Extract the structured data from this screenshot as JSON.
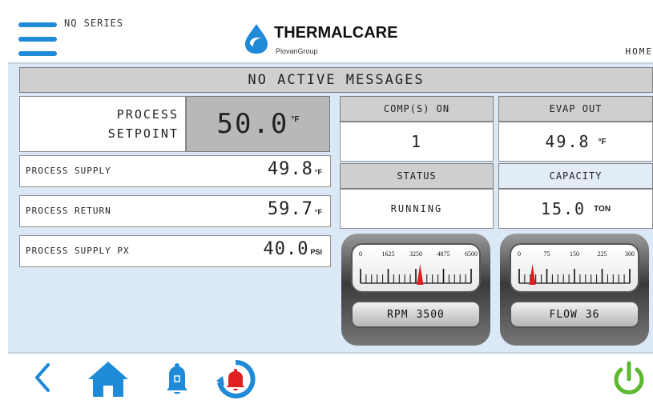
{
  "header": {
    "series_label": "NQ SERIES",
    "logo_text": "THERMALCARE",
    "logo_sub": "PiovanGroup",
    "home_label": "HOME"
  },
  "messages": {
    "text": "NO ACTIVE MESSAGES"
  },
  "setpoint": {
    "label_line1": "PROCESS",
    "label_line2": "SETPOINT",
    "value": "50.0",
    "unit": "°F"
  },
  "rows": [
    {
      "label": "PROCESS SUPPLY",
      "value": "49.8",
      "unit": "°F"
    },
    {
      "label": "PROCESS RETURN",
      "value": "59.7",
      "unit": "°F"
    },
    {
      "label": "PROCESS SUPPLY PX",
      "value": "40.0",
      "unit": "PSI"
    }
  ],
  "status_cells": {
    "comps_header": "COMP(S) ON",
    "comps_value": "1",
    "evap_header": "EVAP OUT",
    "evap_value": "49.8",
    "evap_unit": "°F",
    "status_header": "STATUS",
    "status_value": "RUNNING",
    "capacity_header": "CAPACITY",
    "capacity_value": "15.0",
    "capacity_unit": "TON"
  },
  "gauges": [
    {
      "ticks": [
        "0",
        "1625",
        "3250",
        "4875",
        "6500"
      ],
      "max": 6500,
      "value": 3500,
      "label": "RPM",
      "readout": "3500"
    },
    {
      "ticks": [
        "0",
        "75",
        "150",
        "225",
        "300"
      ],
      "max": 300,
      "value": 36,
      "label": "FLOW",
      "readout": "36"
    }
  ],
  "colors": {
    "accent_blue": "#1f8ad8",
    "power_green": "#5cb82f",
    "alarm_red": "#e02020",
    "needle_red": "#e01b1b",
    "panel_bg": "#dbe9f6"
  },
  "footer_icons": [
    "back-icon",
    "home-icon",
    "bell-icon",
    "alarm-reset-icon",
    "power-icon"
  ]
}
